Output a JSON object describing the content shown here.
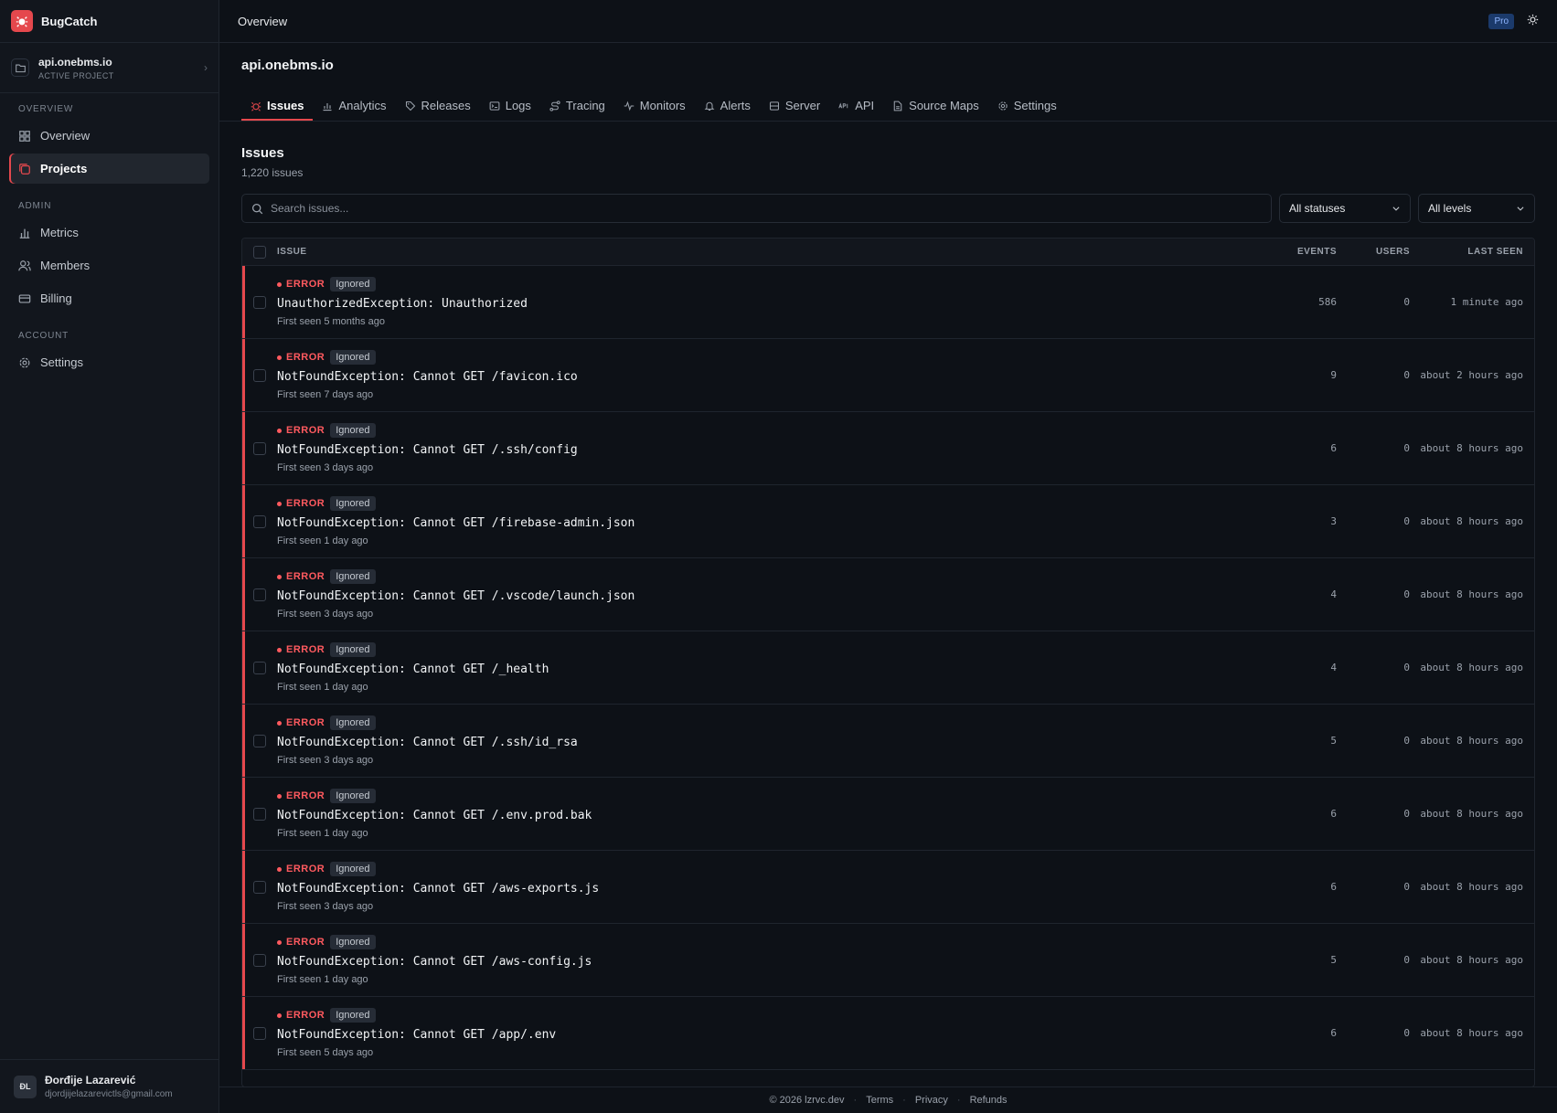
{
  "brand": {
    "name": "BugCatch",
    "icon": "bug-icon",
    "accent": "#e5484d"
  },
  "project_switcher": {
    "name": "api.onebms.io",
    "subtitle": "ACTIVE PROJECT"
  },
  "sidebar": {
    "sections": [
      {
        "heading": "OVERVIEW",
        "items": [
          {
            "label": "Overview",
            "icon": "grid-icon"
          },
          {
            "label": "Projects",
            "icon": "projects-icon",
            "active": true
          }
        ]
      },
      {
        "heading": "ADMIN",
        "items": [
          {
            "label": "Metrics",
            "icon": "bar-chart-icon"
          },
          {
            "label": "Members",
            "icon": "users-icon"
          },
          {
            "label": "Billing",
            "icon": "credit-card-icon"
          }
        ]
      },
      {
        "heading": "ACCOUNT",
        "items": [
          {
            "label": "Settings",
            "icon": "gear-icon"
          }
        ]
      }
    ]
  },
  "user": {
    "initials": "ĐL",
    "name": "Đorđije Lazarević",
    "email": "djordjijelazarevictls@gmail.com"
  },
  "topbar": {
    "title": "Overview",
    "plan_badge": "Pro",
    "theme_icon": "sun-icon"
  },
  "project": {
    "title": "api.onebms.io"
  },
  "tabs": [
    {
      "label": "Issues",
      "icon": "bug-icon",
      "active": true
    },
    {
      "label": "Analytics",
      "icon": "analytics-icon"
    },
    {
      "label": "Releases",
      "icon": "tag-icon"
    },
    {
      "label": "Logs",
      "icon": "terminal-icon"
    },
    {
      "label": "Tracing",
      "icon": "route-icon"
    },
    {
      "label": "Monitors",
      "icon": "pulse-icon"
    },
    {
      "label": "Alerts",
      "icon": "bell-icon"
    },
    {
      "label": "Server",
      "icon": "server-icon"
    },
    {
      "label": "API",
      "icon": "api-icon"
    },
    {
      "label": "Source Maps",
      "icon": "file-icon"
    },
    {
      "label": "Settings",
      "icon": "gear-icon"
    }
  ],
  "issues_section": {
    "title": "Issues",
    "count": "1,220 issues",
    "search_placeholder": "Search issues...",
    "status_filter": "All statuses",
    "level_filter": "All levels"
  },
  "table": {
    "headers": {
      "issue": "ISSUE",
      "events": "EVENTS",
      "users": "USERS",
      "last_seen": "LAST SEEN"
    },
    "rows": [
      {
        "level": "ERROR",
        "status": "Ignored",
        "title": "UnauthorizedException: Unauthorized",
        "first_seen": "First seen 5 months ago",
        "events": "586",
        "users": "0",
        "last_seen": "1 minute ago"
      },
      {
        "level": "ERROR",
        "status": "Ignored",
        "title": "NotFoundException: Cannot GET /favicon.ico",
        "first_seen": "First seen 7 days ago",
        "events": "9",
        "users": "0",
        "last_seen": "about 2 hours ago"
      },
      {
        "level": "ERROR",
        "status": "Ignored",
        "title": "NotFoundException: Cannot GET /.ssh/config",
        "first_seen": "First seen 3 days ago",
        "events": "6",
        "users": "0",
        "last_seen": "about 8 hours ago"
      },
      {
        "level": "ERROR",
        "status": "Ignored",
        "title": "NotFoundException: Cannot GET /firebase-admin.json",
        "first_seen": "First seen 1 day ago",
        "events": "3",
        "users": "0",
        "last_seen": "about 8 hours ago"
      },
      {
        "level": "ERROR",
        "status": "Ignored",
        "title": "NotFoundException: Cannot GET /.vscode/launch.json",
        "first_seen": "First seen 3 days ago",
        "events": "4",
        "users": "0",
        "last_seen": "about 8 hours ago"
      },
      {
        "level": "ERROR",
        "status": "Ignored",
        "title": "NotFoundException: Cannot GET /_health",
        "first_seen": "First seen 1 day ago",
        "events": "4",
        "users": "0",
        "last_seen": "about 8 hours ago"
      },
      {
        "level": "ERROR",
        "status": "Ignored",
        "title": "NotFoundException: Cannot GET /.ssh/id_rsa",
        "first_seen": "First seen 3 days ago",
        "events": "5",
        "users": "0",
        "last_seen": "about 8 hours ago"
      },
      {
        "level": "ERROR",
        "status": "Ignored",
        "title": "NotFoundException: Cannot GET /.env.prod.bak",
        "first_seen": "First seen 1 day ago",
        "events": "6",
        "users": "0",
        "last_seen": "about 8 hours ago"
      },
      {
        "level": "ERROR",
        "status": "Ignored",
        "title": "NotFoundException: Cannot GET /aws-exports.js",
        "first_seen": "First seen 3 days ago",
        "events": "6",
        "users": "0",
        "last_seen": "about 8 hours ago"
      },
      {
        "level": "ERROR",
        "status": "Ignored",
        "title": "NotFoundException: Cannot GET /aws-config.js",
        "first_seen": "First seen 1 day ago",
        "events": "5",
        "users": "0",
        "last_seen": "about 8 hours ago"
      },
      {
        "level": "ERROR",
        "status": "Ignored",
        "title": "NotFoundException: Cannot GET /app/.env",
        "first_seen": "First seen 5 days ago",
        "events": "6",
        "users": "0",
        "last_seen": "about 8 hours ago"
      }
    ]
  },
  "footer": {
    "copyright": "© 2026 lzrvc.dev",
    "links": [
      "Terms",
      "Privacy",
      "Refunds"
    ]
  }
}
